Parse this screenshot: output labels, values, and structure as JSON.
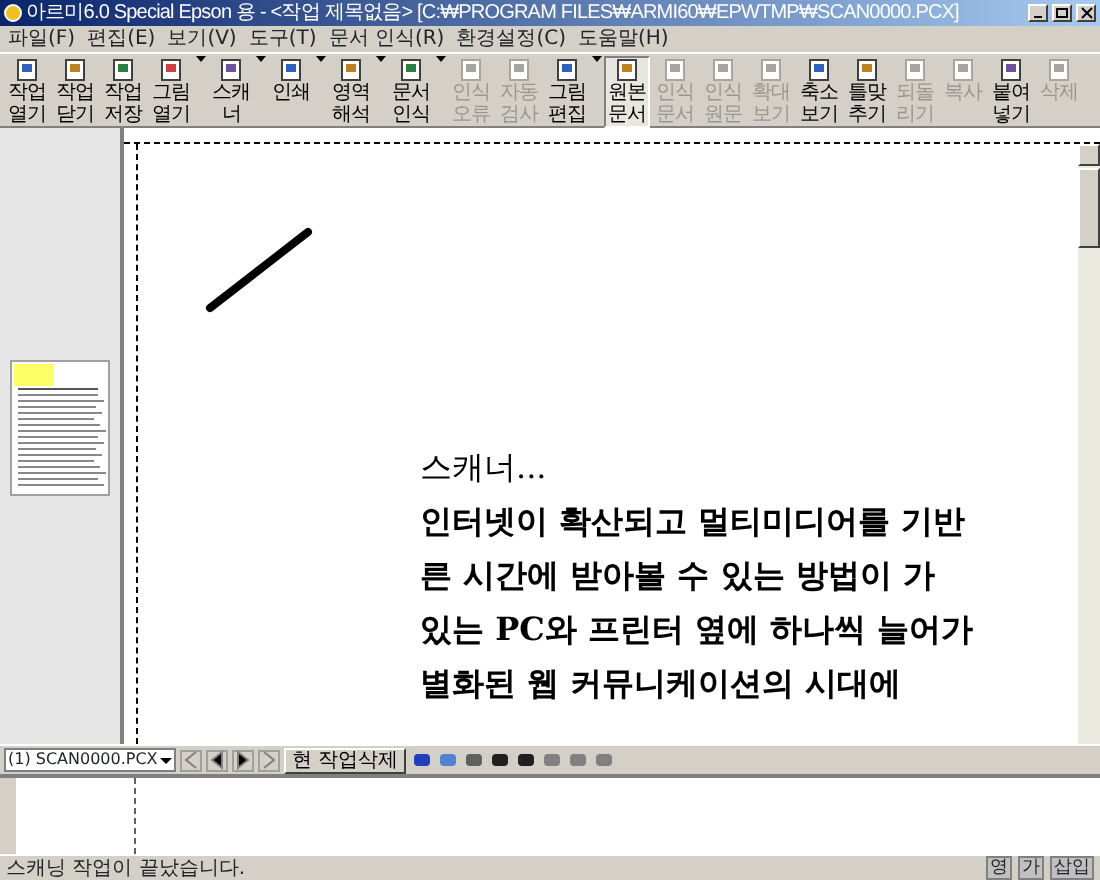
{
  "window": {
    "title": "아르미6.0 Special Epson 용 - <작업 제목없음> [C:₩PROGRAM FILES₩ARMI60₩EPWTMP₩SCAN0000.PCX]"
  },
  "menu": [
    "파일(F)",
    "편집(E)",
    "보기(V)",
    "도구(T)",
    "문서 인식(R)",
    "환경설정(C)",
    "도움말(H)"
  ],
  "toolbar": [
    {
      "label": "작업열기",
      "dropdown": false,
      "disabled": false,
      "pressed": false
    },
    {
      "label": "작업닫기",
      "dropdown": false,
      "disabled": false,
      "pressed": false
    },
    {
      "label": "작업저장",
      "dropdown": false,
      "disabled": false,
      "pressed": false
    },
    {
      "label": "그림열기",
      "dropdown": true,
      "disabled": false,
      "pressed": false
    },
    {
      "label": "스캐너",
      "dropdown": true,
      "disabled": false,
      "pressed": false
    },
    {
      "label": "인쇄",
      "dropdown": true,
      "disabled": false,
      "pressed": false
    },
    {
      "label": "영역해석",
      "dropdown": true,
      "disabled": false,
      "pressed": false
    },
    {
      "label": "문서인식",
      "dropdown": true,
      "disabled": false,
      "pressed": false
    },
    {
      "label": "인식오류",
      "dropdown": false,
      "disabled": true,
      "pressed": false
    },
    {
      "label": "자동검사",
      "dropdown": false,
      "disabled": true,
      "pressed": false
    },
    {
      "label": "그림편집",
      "dropdown": true,
      "disabled": false,
      "pressed": false
    },
    {
      "label": "원본문서",
      "dropdown": false,
      "disabled": false,
      "pressed": true
    },
    {
      "label": "인식문서",
      "dropdown": false,
      "disabled": true,
      "pressed": false
    },
    {
      "label": "인식원문",
      "dropdown": false,
      "disabled": true,
      "pressed": false
    },
    {
      "label": "확대보기",
      "dropdown": false,
      "disabled": true,
      "pressed": false
    },
    {
      "label": "축소보기",
      "dropdown": false,
      "disabled": false,
      "pressed": false
    },
    {
      "label": "틀맞추기",
      "dropdown": false,
      "disabled": false,
      "pressed": false
    },
    {
      "label": "되돌리기",
      "dropdown": false,
      "disabled": true,
      "pressed": false
    },
    {
      "label": "복사",
      "dropdown": false,
      "disabled": true,
      "pressed": false
    },
    {
      "label": "붙여넣기",
      "dropdown": false,
      "disabled": false,
      "pressed": false
    },
    {
      "label": "삭제",
      "dropdown": false,
      "disabled": true,
      "pressed": false
    }
  ],
  "document": {
    "lines": [
      "스캐너...",
      "인터넷이 확산되고 멀티미디어를 기반",
      "른 시간에 받아볼 수 있는 방법이 가",
      "있는 PC와 프린터 옆에 하나씩 늘어가",
      "별화된 웹 커뮤니케이션의 시대에"
    ]
  },
  "page_bar": {
    "file": "(1) SCAN0000.PCX",
    "delete_button": "현 작업삭제"
  },
  "status_bar": {
    "message": "스캐닝 작업이 끝났습니다.",
    "indicators": [
      "영",
      "가",
      "삽입"
    ]
  }
}
